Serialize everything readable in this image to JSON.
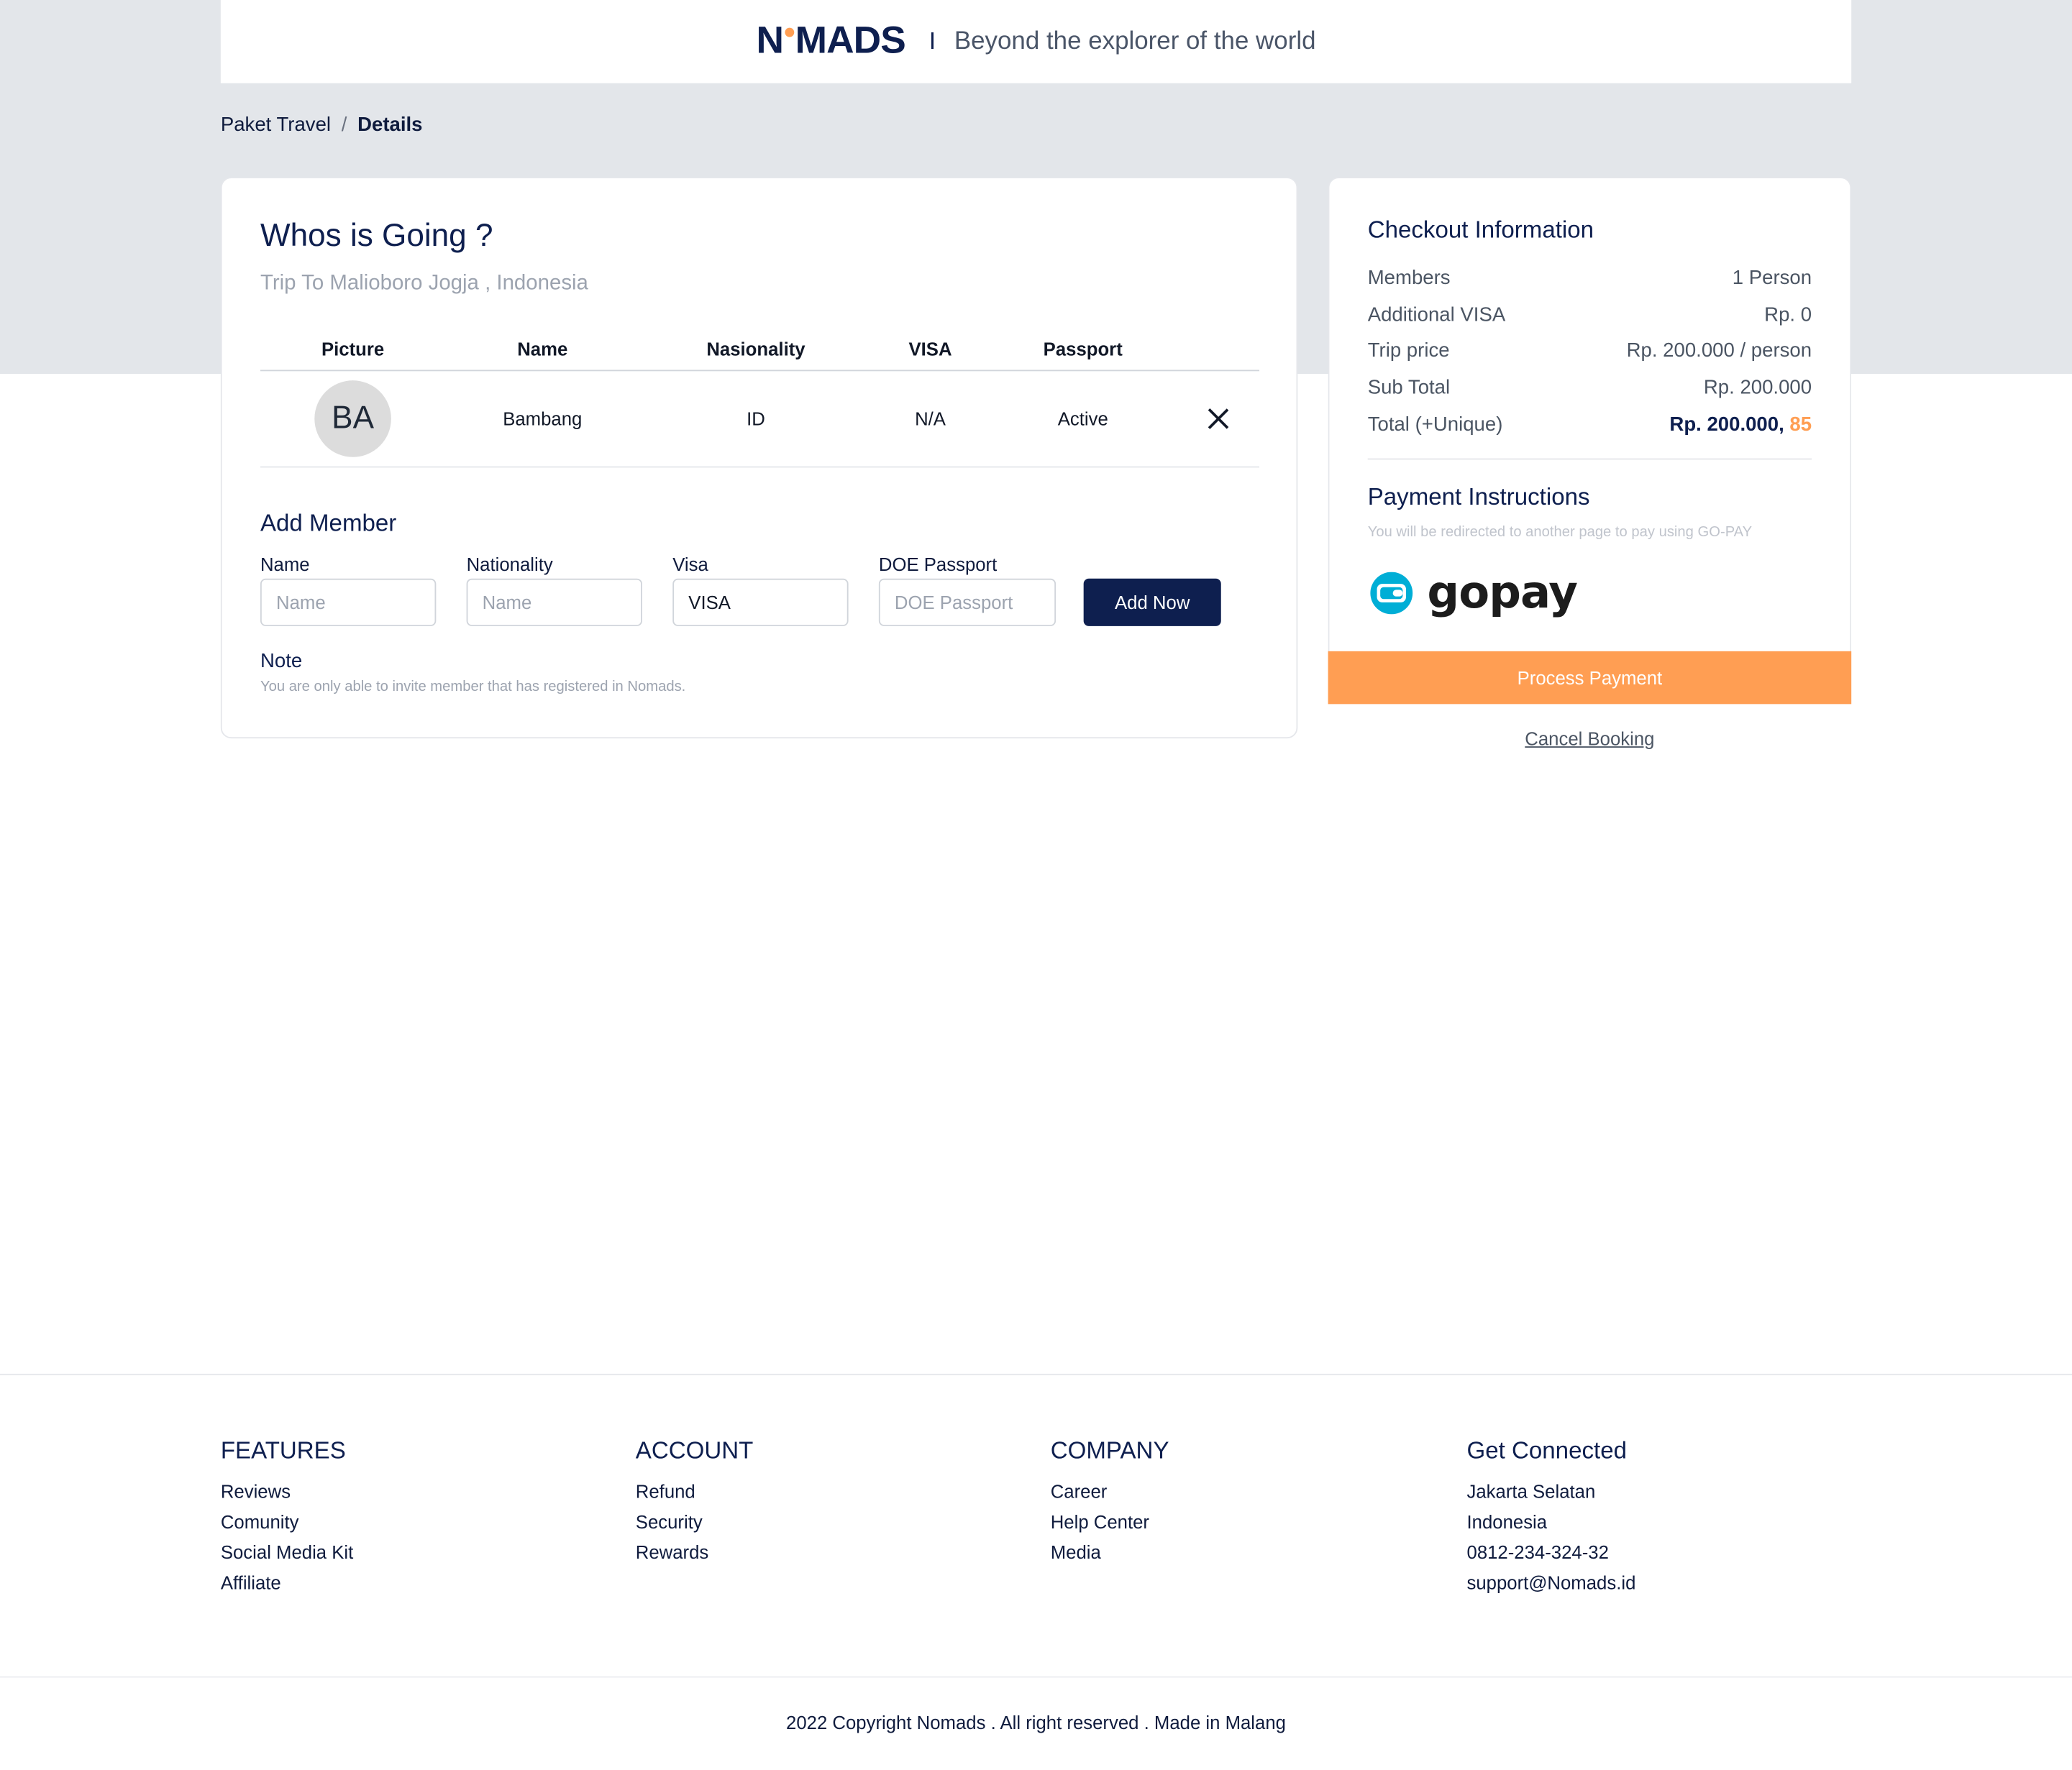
{
  "header": {
    "brand_left": "N",
    "brand_right": "MADS",
    "separator": "I",
    "tagline": "Beyond the explorer of the world"
  },
  "breadcrumb": {
    "parent": "Paket Travel",
    "separator": "/",
    "current": "Details"
  },
  "members_card": {
    "title": "Whos is Going ?",
    "subtitle": "Trip To Malioboro Jogja , Indonesia",
    "columns": [
      "Picture",
      "Name",
      "Nasionality",
      "VISA",
      "Passport"
    ],
    "rows": [
      {
        "initials": "BA",
        "name": "Bambang",
        "nationality": "ID",
        "visa": "N/A",
        "passport": "Active"
      }
    ],
    "add_member": {
      "title": "Add Member",
      "name_label": "Name",
      "name_placeholder": "Name",
      "nationality_label": "Nationality",
      "nationality_placeholder": "Name",
      "visa_label": "Visa",
      "visa_value": "VISA",
      "doe_label": "DOE Passport",
      "doe_placeholder": "DOE Passport",
      "button_label": "Add Now"
    },
    "note": {
      "title": "Note",
      "text": "You are only able to invite member that has registered in Nomads."
    }
  },
  "checkout": {
    "title": "Checkout Information",
    "rows": [
      {
        "label": "Members",
        "value": "1 Person"
      },
      {
        "label": "Additional VISA",
        "value": "Rp. 0"
      },
      {
        "label": "Trip price",
        "value": "Rp. 200.000 / person"
      },
      {
        "label": "Sub Total",
        "value": "Rp. 200.000"
      }
    ],
    "total": {
      "label": "Total (+Unique)",
      "value": "Rp. 200.000,",
      "unique": "85"
    },
    "payment_title": "Payment Instructions",
    "payment_text": "You will be redirected to another page to pay using GO-PAY",
    "payment_method": "gopay",
    "process_button": "Process Payment",
    "cancel_link": "Cancel Booking"
  },
  "footer": {
    "columns": [
      {
        "title": "FEATURES",
        "items": [
          "Reviews",
          "Comunity",
          "Social Media Kit",
          "Affiliate"
        ]
      },
      {
        "title": "ACCOUNT",
        "items": [
          "Refund",
          "Security",
          "Rewards"
        ]
      },
      {
        "title": "COMPANY",
        "items": [
          "Career",
          "Help Center",
          "Media"
        ]
      },
      {
        "title": "Get Connected",
        "items": [
          "Jakarta Selatan",
          "Indonesia",
          "0812-234-324-32",
          "support@Nomads.id"
        ]
      }
    ],
    "copyright": "2022 Copyright Nomads . All right reserved . Made in Malang"
  },
  "colors": {
    "navy": "#0e1f4f",
    "orange": "#ff9e53",
    "band_gray": "#e3e6ea",
    "gopay_blue": "#00aed6"
  },
  "icons": [
    "close-icon",
    "wallet-icon"
  ]
}
